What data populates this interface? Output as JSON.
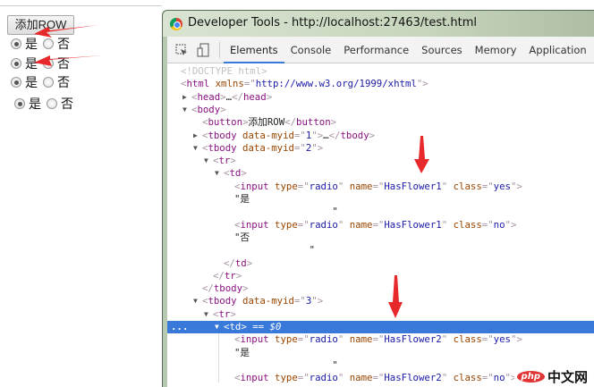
{
  "page": {
    "button_label": "添加ROW",
    "rows": [
      {
        "yes": "是",
        "no": "否",
        "checked": "yes"
      },
      {
        "yes": "是",
        "no": "否",
        "checked": "yes"
      },
      {
        "yes": "是",
        "no": "否",
        "checked": "yes"
      },
      {
        "yes": "是",
        "no": "否",
        "checked": "yes"
      }
    ]
  },
  "devtools": {
    "title": "Developer Tools - http://localhost:27463/test.html",
    "tabs": [
      "Elements",
      "Console",
      "Performance",
      "Sources",
      "Memory",
      "Application"
    ],
    "active_tab": "Elements",
    "selected_marker": "...",
    "lines": [
      {
        "depth": 0,
        "segs": [
          [
            "dt",
            "<!DOCTYPE html>"
          ]
        ]
      },
      {
        "depth": 0,
        "segs": [
          [
            "br",
            "<"
          ],
          [
            "tag",
            "html "
          ],
          [
            "an",
            "xmlns"
          ],
          [
            "br",
            "=\""
          ],
          [
            "av",
            "http://www.w3.org/1999/xhtml"
          ],
          [
            "br",
            "\">"
          ]
        ]
      },
      {
        "depth": 1,
        "arrow": "▶",
        "segs": [
          [
            "br",
            "<"
          ],
          [
            "tag",
            "head"
          ],
          [
            "br",
            ">"
          ],
          [
            "tx",
            "…"
          ],
          [
            "br",
            "</"
          ],
          [
            "tag",
            "head"
          ],
          [
            "br",
            ">"
          ]
        ]
      },
      {
        "depth": 1,
        "arrow": "▼",
        "segs": [
          [
            "br",
            "<"
          ],
          [
            "tag",
            "body"
          ],
          [
            "br",
            ">"
          ]
        ]
      },
      {
        "depth": 2,
        "segs": [
          [
            "br",
            "<"
          ],
          [
            "tag",
            "button"
          ],
          [
            "br",
            ">"
          ],
          [
            "tx",
            "添加ROW"
          ],
          [
            "br",
            "</"
          ],
          [
            "tag",
            "button"
          ],
          [
            "br",
            ">"
          ]
        ]
      },
      {
        "depth": 2,
        "arrow": "▶",
        "segs": [
          [
            "br",
            "<"
          ],
          [
            "tag",
            "tbody "
          ],
          [
            "an",
            "data-myid"
          ],
          [
            "br",
            "=\""
          ],
          [
            "av",
            "1"
          ],
          [
            "br",
            "\">"
          ],
          [
            "tx",
            "…"
          ],
          [
            "br",
            "</"
          ],
          [
            "tag",
            "tbody"
          ],
          [
            "br",
            ">"
          ]
        ]
      },
      {
        "depth": 2,
        "arrow": "▼",
        "segs": [
          [
            "br",
            "<"
          ],
          [
            "tag",
            "tbody "
          ],
          [
            "an",
            "data-myid"
          ],
          [
            "br",
            "=\""
          ],
          [
            "av",
            "2"
          ],
          [
            "br",
            "\">"
          ]
        ]
      },
      {
        "depth": 3,
        "arrow": "▼",
        "segs": [
          [
            "br",
            "<"
          ],
          [
            "tag",
            "tr"
          ],
          [
            "br",
            ">"
          ]
        ]
      },
      {
        "depth": 4,
        "arrow": "▼",
        "segs": [
          [
            "br",
            "<"
          ],
          [
            "tag",
            "td"
          ],
          [
            "br",
            ">"
          ]
        ]
      },
      {
        "depth": 5,
        "segs": [
          [
            "br",
            "<"
          ],
          [
            "tag",
            "input "
          ],
          [
            "an",
            "type"
          ],
          [
            "br",
            "=\""
          ],
          [
            "av",
            "radio"
          ],
          [
            "br",
            "\" "
          ],
          [
            "an",
            "name"
          ],
          [
            "br",
            "=\""
          ],
          [
            "av",
            "HasFlower1"
          ],
          [
            "br",
            "\" "
          ],
          [
            "an",
            "class"
          ],
          [
            "br",
            "=\""
          ],
          [
            "av",
            "yes"
          ],
          [
            "br",
            "\">"
          ]
        ]
      },
      {
        "depth": 5,
        "segs": [
          [
            "tx",
            "\"是"
          ]
        ]
      },
      {
        "depth": 5,
        "segs": [
          [
            "tx",
            "                 \""
          ]
        ]
      },
      {
        "depth": 5,
        "segs": [
          [
            "br",
            "<"
          ],
          [
            "tag",
            "input "
          ],
          [
            "an",
            "type"
          ],
          [
            "br",
            "=\""
          ],
          [
            "av",
            "radio"
          ],
          [
            "br",
            "\" "
          ],
          [
            "an",
            "name"
          ],
          [
            "br",
            "=\""
          ],
          [
            "av",
            "HasFlower1"
          ],
          [
            "br",
            "\" "
          ],
          [
            "an",
            "class"
          ],
          [
            "br",
            "=\""
          ],
          [
            "av",
            "no"
          ],
          [
            "br",
            "\">"
          ]
        ]
      },
      {
        "depth": 5,
        "segs": [
          [
            "tx",
            "\"否"
          ]
        ]
      },
      {
        "depth": 5,
        "segs": [
          [
            "tx",
            "             \""
          ]
        ]
      },
      {
        "depth": 4,
        "segs": [
          [
            "br",
            "</"
          ],
          [
            "tag",
            "td"
          ],
          [
            "br",
            ">"
          ]
        ]
      },
      {
        "depth": 3,
        "segs": [
          [
            "br",
            "</"
          ],
          [
            "tag",
            "tr"
          ],
          [
            "br",
            ">"
          ]
        ]
      },
      {
        "depth": 2,
        "segs": [
          [
            "br",
            "</"
          ],
          [
            "tag",
            "tbody"
          ],
          [
            "br",
            ">"
          ]
        ]
      },
      {
        "depth": 2,
        "arrow": "▼",
        "segs": [
          [
            "br",
            "<"
          ],
          [
            "tag",
            "tbody "
          ],
          [
            "an",
            "data-myid"
          ],
          [
            "br",
            "=\""
          ],
          [
            "av",
            "3"
          ],
          [
            "br",
            "\">"
          ]
        ]
      },
      {
        "depth": 3,
        "arrow": "▼",
        "segs": [
          [
            "br",
            "<"
          ],
          [
            "tag",
            "tr"
          ],
          [
            "br",
            ">"
          ]
        ]
      },
      {
        "depth": 4,
        "arrow": "▼",
        "selected": true,
        "segs": [
          [
            "br",
            "<"
          ],
          [
            "tag",
            "td"
          ],
          [
            "br",
            "> "
          ],
          [
            "eq",
            "== $0"
          ]
        ]
      },
      {
        "depth": 5,
        "segs": [
          [
            "br",
            "<"
          ],
          [
            "tag",
            "input "
          ],
          [
            "an",
            "type"
          ],
          [
            "br",
            "=\""
          ],
          [
            "av",
            "radio"
          ],
          [
            "br",
            "\" "
          ],
          [
            "an",
            "name"
          ],
          [
            "br",
            "=\""
          ],
          [
            "av",
            "HasFlower2"
          ],
          [
            "br",
            "\" "
          ],
          [
            "an",
            "class"
          ],
          [
            "br",
            "=\""
          ],
          [
            "av",
            "yes"
          ],
          [
            "br",
            "\">"
          ]
        ]
      },
      {
        "depth": 5,
        "segs": [
          [
            "tx",
            "\"是"
          ]
        ]
      },
      {
        "depth": 5,
        "segs": [
          [
            "tx",
            "                 \""
          ]
        ]
      },
      {
        "depth": 5,
        "segs": [
          [
            "br",
            "<"
          ],
          [
            "tag",
            "input "
          ],
          [
            "an",
            "type"
          ],
          [
            "br",
            "=\""
          ],
          [
            "av",
            "radio"
          ],
          [
            "br",
            "\" "
          ],
          [
            "an",
            "name"
          ],
          [
            "br",
            "=\""
          ],
          [
            "av",
            "HasFlower2"
          ],
          [
            "br",
            "\" "
          ],
          [
            "an",
            "class"
          ],
          [
            "br",
            "=\""
          ],
          [
            "av",
            "no"
          ],
          [
            "br",
            "\">"
          ]
        ]
      }
    ]
  },
  "watermark": {
    "badge": "php",
    "text": "中文网"
  },
  "colors": {
    "annotation_arrow": "#e8292b",
    "selection": "#3879d9"
  }
}
